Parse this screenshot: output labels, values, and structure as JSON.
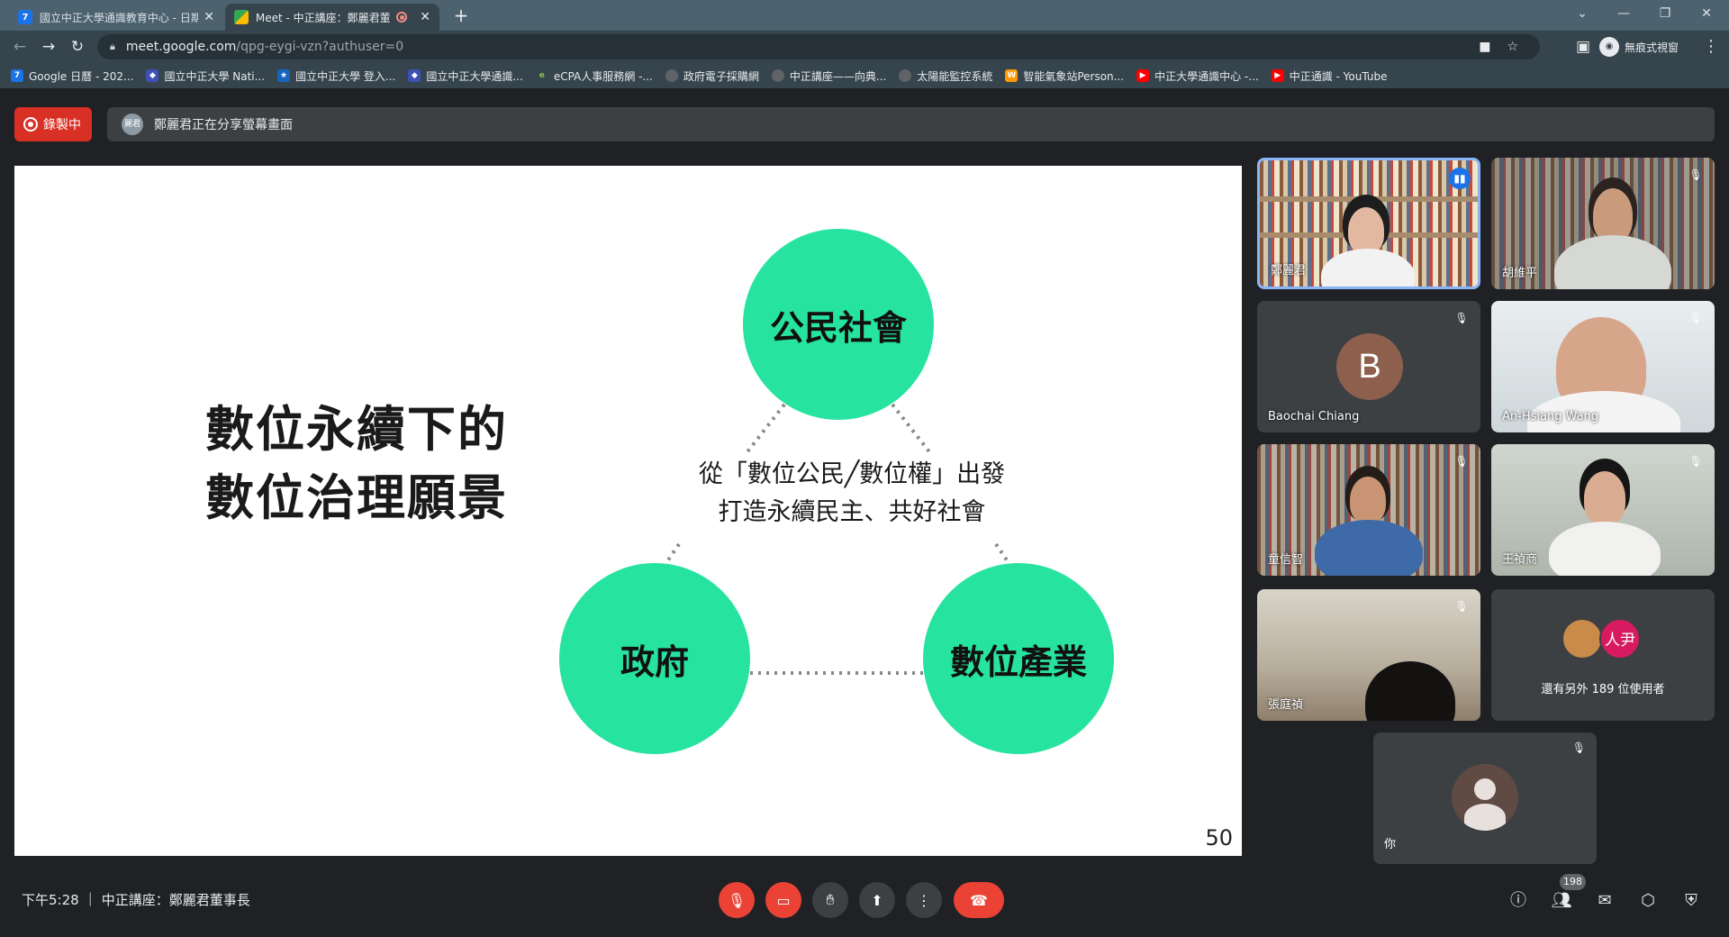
{
  "browser": {
    "tabs": [
      {
        "title": "國立中正大學通識教育中心 - 日期",
        "active": false
      },
      {
        "title": "Meet - 中正講座：鄭麗君董",
        "active": true
      }
    ],
    "url_host": "meet.google.com",
    "url_path": "/qpg-eygi-vzn?authuser=0",
    "profile_label": "無痕式視窗",
    "bookmarks": [
      "Google 日曆 - 202...",
      "國立中正大學 Nati...",
      "國立中正大學 登入...",
      "國立中正大學通識...",
      "eCPA人事服務網 -...",
      "政府電子採購網",
      "中正講座——向典...",
      "太陽能監控系統",
      "智能氣象站Person...",
      "中正大學通識中心 -...",
      "中正通識 - YouTube"
    ]
  },
  "meet": {
    "recording_label": "錄製中",
    "presenter_initials": "麗君",
    "share_text": "鄭麗君正在分享螢幕畫面",
    "slide": {
      "title_line1": "數位永續下的",
      "title_line2": "數位治理願景",
      "circle_top": "公民社會",
      "circle_left": "政府",
      "circle_right": "數位產業",
      "center_line1": "從「數位公民╱數位權」出發",
      "center_line2": "打造永續民主、共好社會",
      "page_number": "50"
    },
    "participants": [
      {
        "name": "鄭麗君"
      },
      {
        "name": "胡維平"
      },
      {
        "name": "Baochai Chiang",
        "initial": "B"
      },
      {
        "name": "An-Hsiang Wang"
      },
      {
        "name": "童信智"
      },
      {
        "name": "王禎商"
      },
      {
        "name": "張庭禎"
      }
    ],
    "others_avatar_text": "人尹",
    "others_text": "還有另外 189 位使用者",
    "self_name": "你",
    "time": "下午5:28",
    "meeting_title": "中正講座：鄭麗君董事長",
    "people_count": "198"
  },
  "colors": {
    "accent_green": "#27e3a0",
    "recording_red": "#d93025",
    "hangup_red": "#ea4335"
  }
}
